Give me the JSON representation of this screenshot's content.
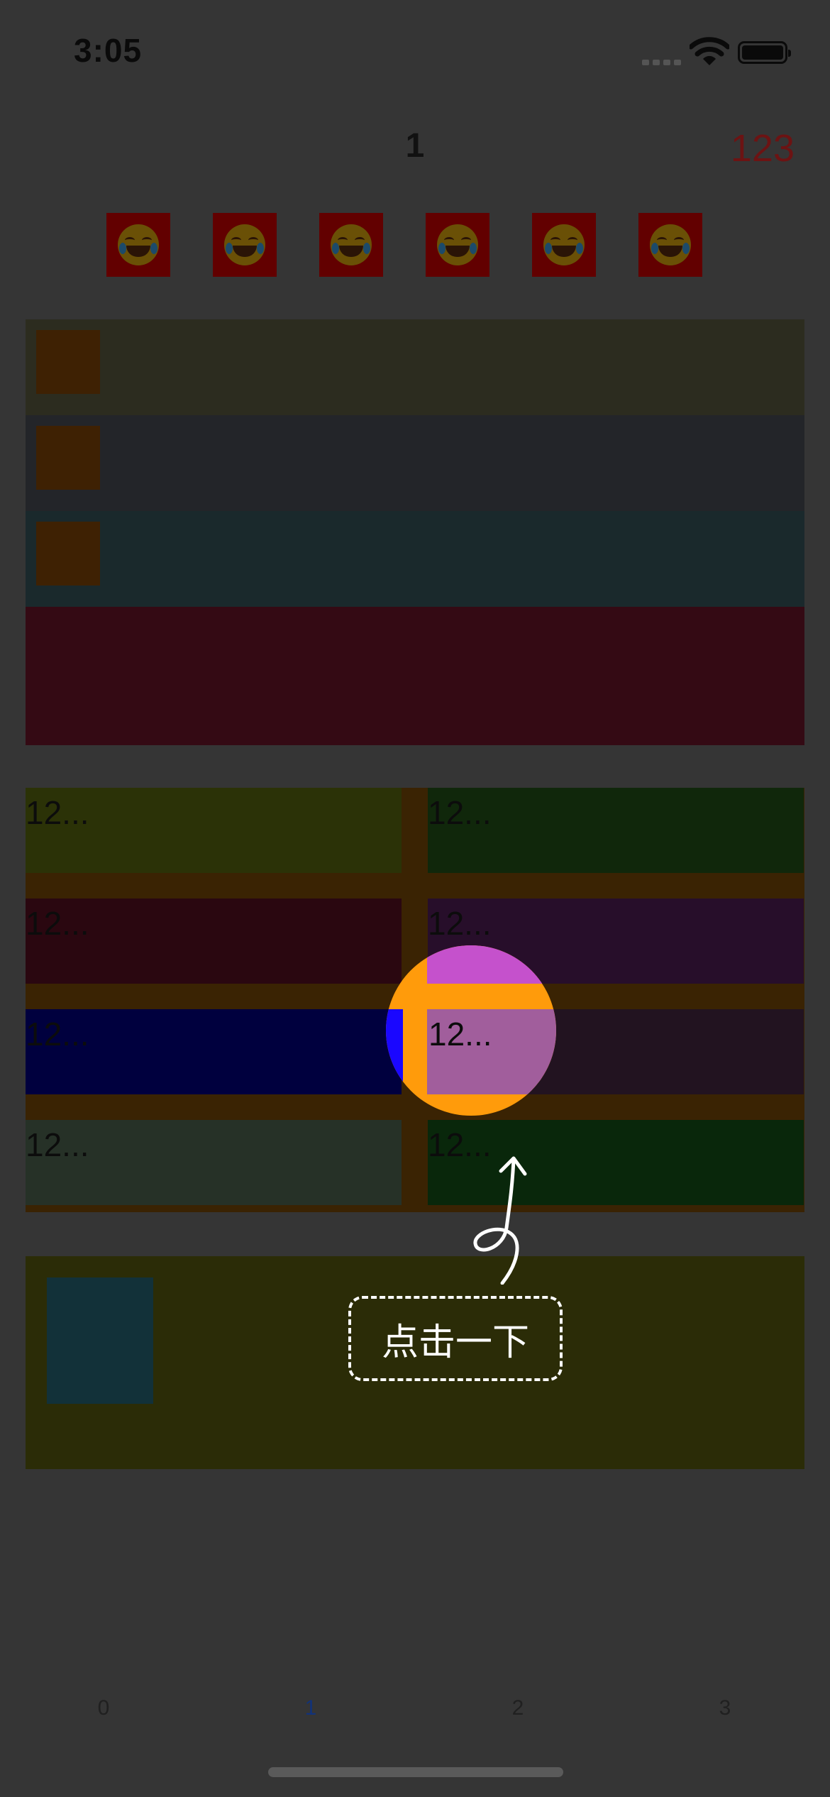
{
  "status_bar": {
    "time": "3:05",
    "icons": [
      "signal-icon",
      "wifi-icon",
      "battery-icon"
    ]
  },
  "nav": {
    "title": "1",
    "right_label": "123"
  },
  "emoji_row": {
    "icon": "face-with-tears-of-joy-icon",
    "count": 6
  },
  "grid": {
    "cells": [
      "12...",
      "12...",
      "12...",
      "12...",
      "12...",
      "12...",
      "12...",
      "12..."
    ]
  },
  "highlight": {
    "cell_label": "12..."
  },
  "hint": {
    "label": "点击一下"
  },
  "tabs": [
    {
      "label": "0"
    },
    {
      "label": "1",
      "selected": true
    },
    {
      "label": "2"
    },
    {
      "label": "3"
    }
  ],
  "colors": {
    "background": "#353535",
    "accent_red": "#6c1313",
    "tab_selected": "#11327a",
    "tab_unselected": "#202020",
    "highlight_orange": "#ff9b0b"
  }
}
